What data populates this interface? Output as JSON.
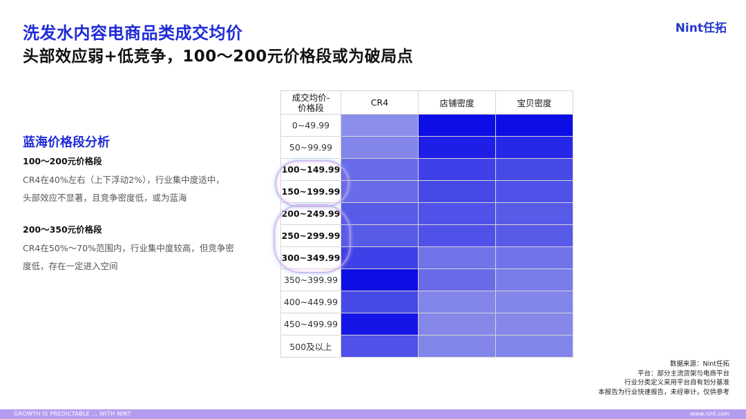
{
  "header": {
    "title_line1": "洗发水内容电商品类成交均价",
    "title_line2": "头部效应弱+低竞争，100～200元价格段或为破局点",
    "logo": "Nint任拓"
  },
  "analysis": {
    "section_title": "蓝海价格段分析",
    "blocks": [
      {
        "heading": "100～200元价格段",
        "line1": "CR4在40%左右（上下浮动2%），行业集中度适中，",
        "line2": "头部效应不显著，且竞争密度低，或为蓝海"
      },
      {
        "heading": "200～350元价格段",
        "line1": "CR4在50%～70%范围内，行业集中度较高，但竞争密",
        "line2": "度低，存在一定进入空间"
      }
    ]
  },
  "chart_data": {
    "type": "heatmap",
    "corner_label_line1": "成交均价-",
    "corner_label_line2": "价格段",
    "columns": [
      "CR4",
      "店铺密度",
      "宝贝密度"
    ],
    "rows": [
      "0~49.99",
      "50~99.99",
      "100~149.99",
      "150~199.99",
      "200~249.99",
      "250~299.99",
      "300~349.99",
      "350~399.99",
      "400~449.99",
      "450~499.99",
      "500及以上"
    ],
    "highlighted_rows": [
      "100~149.99",
      "150~199.99",
      "200~249.99",
      "250~299.99",
      "300~349.99"
    ],
    "intensity": [
      [
        0.25,
        1.0,
        1.0
      ],
      [
        0.3,
        0.9,
        0.85
      ],
      [
        0.45,
        0.7,
        0.65
      ],
      [
        0.45,
        0.65,
        0.6
      ],
      [
        0.55,
        0.6,
        0.55
      ],
      [
        0.55,
        0.6,
        0.55
      ],
      [
        0.7,
        0.4,
        0.4
      ],
      [
        1.0,
        0.45,
        0.35
      ],
      [
        0.65,
        0.3,
        0.3
      ],
      [
        0.95,
        0.28,
        0.28
      ],
      [
        0.6,
        0.3,
        0.3
      ]
    ],
    "color_low": "#b4b8ea",
    "color_high": "#0d0de6"
  },
  "source": {
    "line1": "数据来源：Nint任拓",
    "line2": "平台：部分主流货架与电商平台",
    "line3": "行业分类定义采用平台自有划分基准",
    "line4": "本报告为行业快速报告，未经审计，仅供参考"
  },
  "footer": {
    "left": "GROWTH IS PREDICTABLE ... WITH NINT",
    "right": "www.nint.com",
    "color": "#b69cf0"
  }
}
